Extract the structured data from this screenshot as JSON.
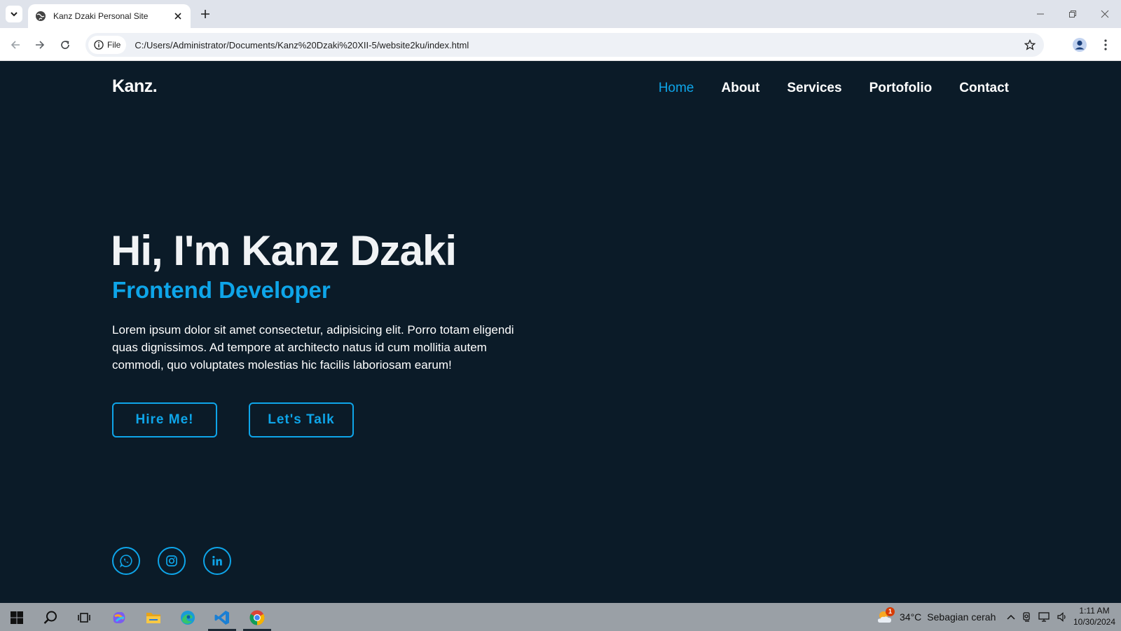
{
  "browser": {
    "tab_title": "Kanz Dzaki Personal Site",
    "site_chip_label": "File",
    "url": "C:/Users/Administrator/Documents/Kanz%20Dzaki%20XII-5/website2ku/index.html"
  },
  "site": {
    "logo": "Kanz.",
    "nav": {
      "home": "Home",
      "about": "About",
      "services": "Services",
      "portfolio": "Portofolio",
      "contact": "Contact"
    },
    "hero": {
      "title": "Hi, I'm Kanz Dzaki",
      "subtitle": "Frontend Developer",
      "description": "Lorem ipsum dolor sit amet consectetur, adipisicing elit. Porro totam eligendi quas dignissimos. Ad tempore at architecto natus id cum mollitia autem commodi, quo voluptates molestias hic facilis laboriosam earum!",
      "hire_button": "Hire Me!",
      "talk_button": "Let's Talk"
    },
    "social": [
      "whatsapp-icon",
      "instagram-icon",
      "linkedin-icon"
    ]
  },
  "taskbar": {
    "weather_badge": "1",
    "temperature": "34°C",
    "weather_text": "Sebagian cerah",
    "time": "1:11 AM",
    "date": "10/30/2024"
  },
  "colors": {
    "accent": "#0ea5e9",
    "background": "#0b1b28",
    "text": "#ffffff"
  }
}
